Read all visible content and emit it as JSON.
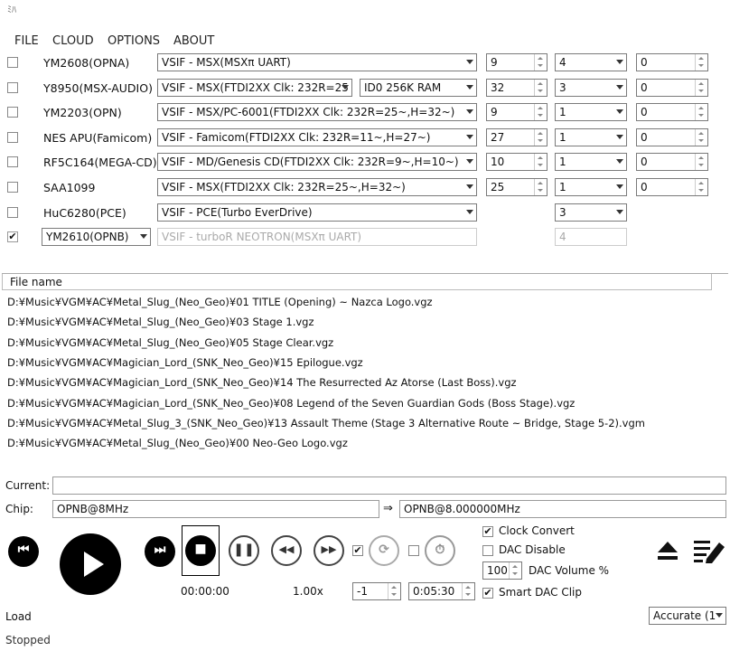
{
  "window": {
    "title": "ﾐﾊ"
  },
  "menu": [
    {
      "label": "FILE"
    },
    {
      "label": "CLOUD"
    },
    {
      "label": "OPTIONS"
    },
    {
      "label": "ABOUT"
    }
  ],
  "chips": [
    {
      "checked": false,
      "name": "YM2608(OPNA)",
      "device": "VSIF - MSX(MSXπ UART)",
      "option": "",
      "clock": "9",
      "volume_sel": "4",
      "extra": "0"
    },
    {
      "checked": false,
      "name": "Y8950(MSX-AUDIO)",
      "device": "VSIF - MSX(FTDI2XX Clk: 232R=25",
      "option": "ID0 256K RAM",
      "clock": "32",
      "volume_sel": "3",
      "extra": "0"
    },
    {
      "checked": false,
      "name": "YM2203(OPN)",
      "device": "VSIF - MSX/PC-6001(FTDI2XX Clk: 232R=25~,H=32~)",
      "option": "",
      "clock": "9",
      "volume_sel": "1",
      "extra": "0"
    },
    {
      "checked": false,
      "name": "NES APU(Famicom)",
      "device": "VSIF - Famicom(FTDI2XX Clk: 232R=11~,H=27~)",
      "option": "",
      "clock": "27",
      "volume_sel": "1",
      "extra": "0"
    },
    {
      "checked": false,
      "name": "RF5C164(MEGA-CD)",
      "device": "VSIF - MD/Genesis CD(FTDI2XX Clk: 232R=9~,H=10~)",
      "option": "",
      "clock": "10",
      "volume_sel": "1",
      "extra": "0"
    },
    {
      "checked": false,
      "name": "SAA1099",
      "device": "VSIF - MSX(FTDI2XX Clk: 232R=25~,H=32~)",
      "option": "",
      "clock": "25",
      "volume_sel": "1",
      "extra": "0"
    },
    {
      "checked": false,
      "name": "HuC6280(PCE)",
      "device": "VSIF - PCE(Turbo EverDrive)",
      "option": "",
      "clock": "",
      "volume_sel": "3",
      "extra": ""
    },
    {
      "checked": true,
      "name": "YM2610(OPNB)",
      "device": "VSIF - turboR NEOTRON(MSXπ UART)",
      "option": "",
      "clock": "",
      "volume_sel": "4",
      "extra": ""
    }
  ],
  "checkmark": "✔",
  "filelist": {
    "header": "File name",
    "items": [
      "D:¥Music¥VGM¥AC¥Metal_Slug_(Neo_Geo)¥01 TITLE (Opening) ~ Nazca Logo.vgz",
      "D:¥Music¥VGM¥AC¥Metal_Slug_(Neo_Geo)¥03 Stage 1.vgz",
      "D:¥Music¥VGM¥AC¥Metal_Slug_(Neo_Geo)¥05 Stage Clear.vgz",
      "D:¥Music¥VGM¥AC¥Magician_Lord_(SNK_Neo_Geo)¥15 Epilogue.vgz",
      "D:¥Music¥VGM¥AC¥Magician_Lord_(SNK_Neo_Geo)¥14 The Resurrected Az Atorse (Last Boss).vgz",
      "D:¥Music¥VGM¥AC¥Magician_Lord_(SNK_Neo_Geo)¥08 Legend of the Seven Guardian Gods (Boss Stage).vgz",
      "D:¥Music¥VGM¥AC¥Metal_Slug_3_(SNK_Neo_Geo)¥13 Assault Theme (Stage 3 Alternative Route ~ Bridge, Stage 5-2).vgm",
      "D:¥Music¥VGM¥AC¥Metal_Slug_(Neo_Geo)¥00 Neo-Geo Logo.vgz"
    ]
  },
  "current": {
    "label": "Current:",
    "value": ""
  },
  "chip_info": {
    "label": "Chip:",
    "value": "OPNB@8MHz",
    "arrow": "⇒",
    "converted": "OPNB@8.000000MHz"
  },
  "transport": {
    "time": "00:00:00",
    "speed": "1.00x",
    "loop_count": "-1",
    "duration": "0:05:30"
  },
  "options": {
    "clock_convert": {
      "label": "Clock Convert",
      "checked": true
    },
    "dac_disable": {
      "label": "DAC Disable",
      "checked": false
    },
    "dac_volume": {
      "value": "100",
      "label": "DAC Volume %"
    },
    "smart_dac_clip": {
      "label": "Smart DAC Clip",
      "checked": true
    }
  },
  "bottom": {
    "load_label": "Load",
    "accuracy": "Accurate (1",
    "status": "Stopped"
  }
}
